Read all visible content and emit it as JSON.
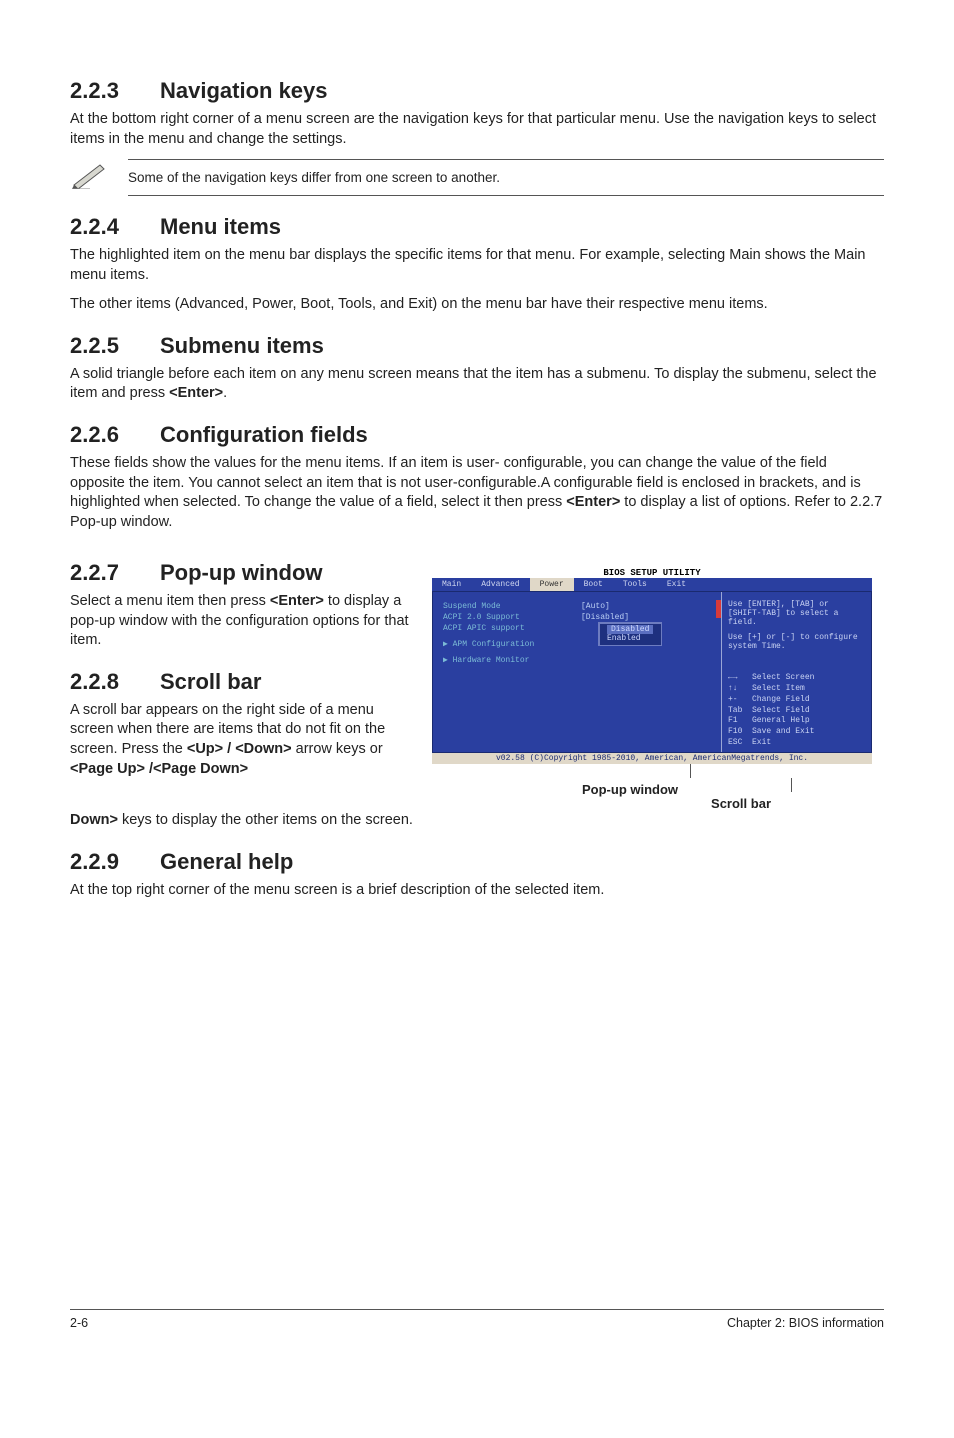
{
  "sections": {
    "nav_keys": {
      "num": "2.2.3",
      "title": "Navigation keys",
      "para": "At the bottom right corner of a menu screen are the navigation keys for that particular menu. Use the navigation keys to select items in the menu and change the settings.",
      "note": "Some of the navigation keys differ from one screen to another."
    },
    "menu_items": {
      "num": "2.2.4",
      "title": "Menu items",
      "para1": "The highlighted item on the menu bar displays the specific items for that menu. For example, selecting Main shows the Main menu items.",
      "para2": "The other items (Advanced, Power, Boot, Tools, and Exit) on the menu bar have their respective menu items."
    },
    "submenu": {
      "num": "2.2.5",
      "title": "Submenu items",
      "para_a": "A solid triangle before each item on any menu screen means that the item has a submenu. To display the submenu, select the item and press ",
      "para_b": "<Enter>",
      "para_c": "."
    },
    "config_fields": {
      "num": "2.2.6",
      "title": "Configuration fields",
      "para_a": "These fields show the values for the menu items. If an item is user- configurable, you can change the value of the field opposite the item. You cannot select an item that is not user-configurable.A configurable field is enclosed in brackets, and is highlighted when selected. To change the value of a field, select it then press ",
      "para_b": "<Enter>",
      "para_c": " to display a list of options. Refer to 2.2.7 Pop-up window."
    },
    "popup": {
      "num": "2.2.7",
      "title": "Pop-up window",
      "para_a": "Select a menu item then press ",
      "para_b": "<Enter>",
      "para_c": " to display a pop-up window with the configuration options for that item."
    },
    "scroll_bar": {
      "num": "2.2.8",
      "title": "Scroll bar",
      "para_a": "A scroll bar appears on the right side of a menu screen when there are items that do not fit on the screen. Press the ",
      "para_b": "<Up> / <Down>",
      "para_c": " arrow keys or ",
      "para_d": "<Page Up> /<Page Down>",
      "para_e": " keys to display the other items on the screen."
    },
    "general_help": {
      "num": "2.2.9",
      "title": "General help",
      "para": "At the top right corner of the menu screen is a brief description of the selected item."
    }
  },
  "bios": {
    "title_bar": "BIOS SETUP UTILITY",
    "tabs": [
      "Main",
      "Advanced",
      "Power",
      "Boot",
      "Tools",
      "Exit"
    ],
    "items": [
      {
        "k": "Suspend Mode",
        "v": "[Auto]"
      },
      {
        "k": "ACPI 2.0 Support",
        "v": "[Disabled]"
      },
      {
        "k": "ACPI APIC support",
        "v": ""
      }
    ],
    "subs": [
      "APM Configuration",
      "Hardware Monitor"
    ],
    "popup_options": [
      "Disabled",
      "Enabled"
    ],
    "help1": "Use [ENTER], [TAB] or [SHIFT-TAB] to select a field.",
    "help2": "Use [+] or [-] to configure system Time.",
    "keys": "←→   Select Screen\n↑↓   Select Item\n+-   Change Field\nTab  Select Field\nF1   General Help\nF10  Save and Exit\nESC  Exit",
    "footer": "v02.58 (C)Copyright 1985-2010, American, AmericanMegatrends, Inc."
  },
  "annotations": {
    "popup_label": "Pop-up window",
    "scroll_label": "Scroll bar"
  },
  "footer": {
    "left": "2-6",
    "right": "Chapter 2: BIOS information"
  }
}
